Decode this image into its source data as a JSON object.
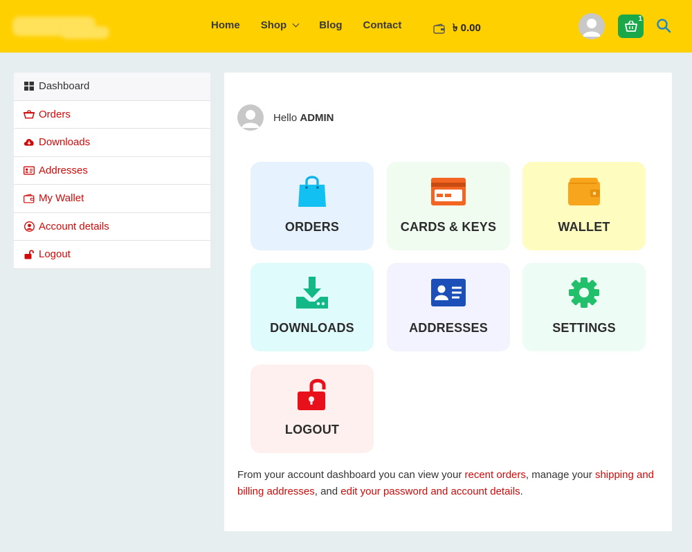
{
  "header": {
    "nav": [
      {
        "label": "Home"
      },
      {
        "label": "Shop"
      },
      {
        "label": "Blog"
      },
      {
        "label": "Contact"
      }
    ],
    "wallet_balance": "৳ 0.00",
    "cart_count": "1"
  },
  "sidebar": {
    "items": [
      {
        "label": "Dashboard",
        "icon": "dashboard-icon"
      },
      {
        "label": "Orders",
        "icon": "basket-icon"
      },
      {
        "label": "Downloads",
        "icon": "cloud-download-icon"
      },
      {
        "label": "Addresses",
        "icon": "address-card-icon"
      },
      {
        "label": "My Wallet",
        "icon": "wallet-icon"
      },
      {
        "label": "Account details",
        "icon": "user-circle-icon"
      },
      {
        "label": "Logout",
        "icon": "unlock-icon"
      }
    ]
  },
  "main": {
    "greeting": "Hello",
    "username": "ADMIN",
    "tiles": [
      {
        "label": "ORDERS",
        "icon": "shopping-bag-icon",
        "bg": "#e6f3ff"
      },
      {
        "label": "CARDS & KEYS",
        "icon": "credit-card-icon",
        "bg": "#effcef"
      },
      {
        "label": "WALLET",
        "icon": "wallet-icon",
        "bg": "#fefcbf"
      },
      {
        "label": "DOWNLOADS",
        "icon": "download-icon",
        "bg": "#e0fbfc"
      },
      {
        "label": "ADDRESSES",
        "icon": "id-card-icon",
        "bg": "#f3f2ff"
      },
      {
        "label": "SETTINGS",
        "icon": "gear-icon",
        "bg": "#edfcf5"
      },
      {
        "label": "LOGOUT",
        "icon": "unlock-icon",
        "bg": "#fff0f0"
      }
    ],
    "description": {
      "part1": "From your account dashboard you can view your ",
      "link1": "recent orders",
      "part2": ", manage your ",
      "link2": "shipping and billing addresses",
      "part3": ", and ",
      "link3": "edit your password and account details",
      "part4": "."
    }
  },
  "colors": {
    "header_bg": "#ffd000",
    "accent_red": "#d10a0a",
    "cart_green": "#1aa84a",
    "search_blue": "#1e88c7"
  }
}
